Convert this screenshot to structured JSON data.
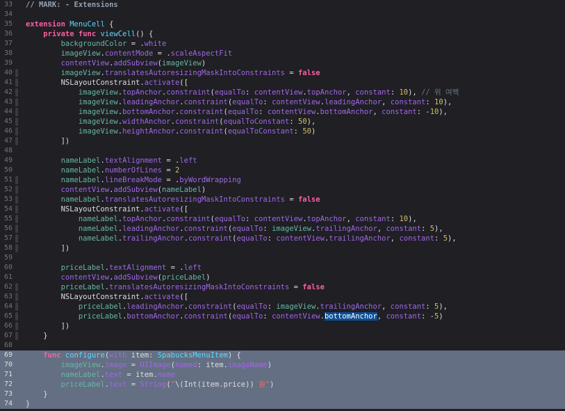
{
  "editor": {
    "first_line": 33,
    "selected_lines": [
      69,
      70,
      71,
      72,
      73,
      74
    ],
    "fold_ribbon_lines": [
      40,
      41,
      42,
      43,
      44,
      45,
      46,
      47,
      51,
      52,
      53,
      54,
      55,
      56,
      57,
      58,
      62,
      63,
      64,
      65,
      66,
      67
    ],
    "lines": [
      [
        {
          "t": "// MARK: - Extensions",
          "c": "mk"
        }
      ],
      [],
      [
        {
          "t": "extension",
          "c": "kw"
        },
        {
          "t": " "
        },
        {
          "t": "MenuCell",
          "c": "ty"
        },
        {
          "t": " {"
        }
      ],
      [
        {
          "t": "    "
        },
        {
          "t": "private",
          "c": "kw"
        },
        {
          "t": " "
        },
        {
          "t": "func",
          "c": "kw"
        },
        {
          "t": " "
        },
        {
          "t": "viewCell",
          "c": "ty"
        },
        {
          "t": "() {"
        }
      ],
      [
        {
          "t": "        "
        },
        {
          "t": "backgroundColor",
          "c": "prop"
        },
        {
          "t": " = ."
        },
        {
          "t": "white",
          "c": "fn"
        }
      ],
      [
        {
          "t": "        "
        },
        {
          "t": "imageView",
          "c": "prop"
        },
        {
          "t": "."
        },
        {
          "t": "contentMode",
          "c": "fn"
        },
        {
          "t": " = ."
        },
        {
          "t": "scaleAspectFit",
          "c": "fn"
        }
      ],
      [
        {
          "t": "        "
        },
        {
          "t": "contentView",
          "c": "fn"
        },
        {
          "t": "."
        },
        {
          "t": "addSubview",
          "c": "fn"
        },
        {
          "t": "("
        },
        {
          "t": "imageView",
          "c": "prop"
        },
        {
          "t": ")"
        }
      ],
      [
        {
          "t": "        "
        },
        {
          "t": "imageView",
          "c": "prop"
        },
        {
          "t": "."
        },
        {
          "t": "translatesAutoresizingMaskIntoConstraints",
          "c": "fn"
        },
        {
          "t": " = "
        },
        {
          "t": "false",
          "c": "kw"
        }
      ],
      [
        {
          "t": "        NSLayoutConstraint."
        },
        {
          "t": "activate",
          "c": "fn"
        },
        {
          "t": "(["
        }
      ],
      [
        {
          "t": "            "
        },
        {
          "t": "imageView",
          "c": "prop"
        },
        {
          "t": "."
        },
        {
          "t": "topAnchor",
          "c": "fn"
        },
        {
          "t": "."
        },
        {
          "t": "constraint",
          "c": "fn"
        },
        {
          "t": "("
        },
        {
          "t": "equalTo",
          "c": "fn"
        },
        {
          "t": ": "
        },
        {
          "t": "contentView",
          "c": "fn"
        },
        {
          "t": "."
        },
        {
          "t": "topAnchor",
          "c": "fn"
        },
        {
          "t": ", "
        },
        {
          "t": "constant",
          "c": "fn"
        },
        {
          "t": ": "
        },
        {
          "t": "10",
          "c": "num"
        },
        {
          "t": "), "
        },
        {
          "t": "// 위 여백",
          "c": "cm"
        }
      ],
      [
        {
          "t": "            "
        },
        {
          "t": "imageView",
          "c": "prop"
        },
        {
          "t": "."
        },
        {
          "t": "leadingAnchor",
          "c": "fn"
        },
        {
          "t": "."
        },
        {
          "t": "constraint",
          "c": "fn"
        },
        {
          "t": "("
        },
        {
          "t": "equalTo",
          "c": "fn"
        },
        {
          "t": ": "
        },
        {
          "t": "contentView",
          "c": "fn"
        },
        {
          "t": "."
        },
        {
          "t": "leadingAnchor",
          "c": "fn"
        },
        {
          "t": ", "
        },
        {
          "t": "constant",
          "c": "fn"
        },
        {
          "t": ": "
        },
        {
          "t": "10",
          "c": "num"
        },
        {
          "t": "),"
        }
      ],
      [
        {
          "t": "            "
        },
        {
          "t": "imageView",
          "c": "prop"
        },
        {
          "t": "."
        },
        {
          "t": "bottomAnchor",
          "c": "fn"
        },
        {
          "t": "."
        },
        {
          "t": "constraint",
          "c": "fn"
        },
        {
          "t": "("
        },
        {
          "t": "equalTo",
          "c": "fn"
        },
        {
          "t": ": "
        },
        {
          "t": "contentView",
          "c": "fn"
        },
        {
          "t": "."
        },
        {
          "t": "bottomAnchor",
          "c": "fn"
        },
        {
          "t": ", "
        },
        {
          "t": "constant",
          "c": "fn"
        },
        {
          "t": ": -"
        },
        {
          "t": "10",
          "c": "num"
        },
        {
          "t": "),"
        }
      ],
      [
        {
          "t": "            "
        },
        {
          "t": "imageView",
          "c": "prop"
        },
        {
          "t": "."
        },
        {
          "t": "widthAnchor",
          "c": "fn"
        },
        {
          "t": "."
        },
        {
          "t": "constraint",
          "c": "fn"
        },
        {
          "t": "("
        },
        {
          "t": "equalToConstant",
          "c": "fn"
        },
        {
          "t": ": "
        },
        {
          "t": "50",
          "c": "num"
        },
        {
          "t": "),"
        }
      ],
      [
        {
          "t": "            "
        },
        {
          "t": "imageView",
          "c": "prop"
        },
        {
          "t": "."
        },
        {
          "t": "heightAnchor",
          "c": "fn"
        },
        {
          "t": "."
        },
        {
          "t": "constraint",
          "c": "fn"
        },
        {
          "t": "("
        },
        {
          "t": "equalToConstant",
          "c": "fn"
        },
        {
          "t": ": "
        },
        {
          "t": "50",
          "c": "num"
        },
        {
          "t": ")"
        }
      ],
      [
        {
          "t": "        ])"
        }
      ],
      [
        {
          "t": "        "
        }
      ],
      [
        {
          "t": "        "
        },
        {
          "t": "nameLabel",
          "c": "prop"
        },
        {
          "t": "."
        },
        {
          "t": "textAlignment",
          "c": "fn"
        },
        {
          "t": " = ."
        },
        {
          "t": "left",
          "c": "fn"
        }
      ],
      [
        {
          "t": "        "
        },
        {
          "t": "nameLabel",
          "c": "prop"
        },
        {
          "t": "."
        },
        {
          "t": "numberOfLines",
          "c": "fn"
        },
        {
          "t": " = "
        },
        {
          "t": "2",
          "c": "num"
        }
      ],
      [
        {
          "t": "        "
        },
        {
          "t": "nameLabel",
          "c": "prop"
        },
        {
          "t": "."
        },
        {
          "t": "lineBreakMode",
          "c": "fn"
        },
        {
          "t": " = ."
        },
        {
          "t": "byWordWrapping",
          "c": "fn"
        }
      ],
      [
        {
          "t": "        "
        },
        {
          "t": "contentView",
          "c": "fn"
        },
        {
          "t": "."
        },
        {
          "t": "addSubview",
          "c": "fn"
        },
        {
          "t": "("
        },
        {
          "t": "nameLabel",
          "c": "prop"
        },
        {
          "t": ")"
        }
      ],
      [
        {
          "t": "        "
        },
        {
          "t": "nameLabel",
          "c": "prop"
        },
        {
          "t": "."
        },
        {
          "t": "translatesAutoresizingMaskIntoConstraints",
          "c": "fn"
        },
        {
          "t": " = "
        },
        {
          "t": "false",
          "c": "kw"
        }
      ],
      [
        {
          "t": "        NSLayoutConstraint."
        },
        {
          "t": "activate",
          "c": "fn"
        },
        {
          "t": "(["
        }
      ],
      [
        {
          "t": "            "
        },
        {
          "t": "nameLabel",
          "c": "prop"
        },
        {
          "t": "."
        },
        {
          "t": "topAnchor",
          "c": "fn"
        },
        {
          "t": "."
        },
        {
          "t": "constraint",
          "c": "fn"
        },
        {
          "t": "("
        },
        {
          "t": "equalTo",
          "c": "fn"
        },
        {
          "t": ": "
        },
        {
          "t": "contentView",
          "c": "fn"
        },
        {
          "t": "."
        },
        {
          "t": "topAnchor",
          "c": "fn"
        },
        {
          "t": ", "
        },
        {
          "t": "constant",
          "c": "fn"
        },
        {
          "t": ": "
        },
        {
          "t": "10",
          "c": "num"
        },
        {
          "t": "),"
        }
      ],
      [
        {
          "t": "            "
        },
        {
          "t": "nameLabel",
          "c": "prop"
        },
        {
          "t": "."
        },
        {
          "t": "leadingAnchor",
          "c": "fn"
        },
        {
          "t": "."
        },
        {
          "t": "constraint",
          "c": "fn"
        },
        {
          "t": "("
        },
        {
          "t": "equalTo",
          "c": "fn"
        },
        {
          "t": ": "
        },
        {
          "t": "imageView",
          "c": "prop"
        },
        {
          "t": "."
        },
        {
          "t": "trailingAnchor",
          "c": "fn"
        },
        {
          "t": ", "
        },
        {
          "t": "constant",
          "c": "fn"
        },
        {
          "t": ": "
        },
        {
          "t": "5",
          "c": "num"
        },
        {
          "t": "),"
        }
      ],
      [
        {
          "t": "            "
        },
        {
          "t": "nameLabel",
          "c": "prop"
        },
        {
          "t": "."
        },
        {
          "t": "trailingAnchor",
          "c": "fn"
        },
        {
          "t": "."
        },
        {
          "t": "constraint",
          "c": "fn"
        },
        {
          "t": "("
        },
        {
          "t": "equalTo",
          "c": "fn"
        },
        {
          "t": ": "
        },
        {
          "t": "contentView",
          "c": "fn"
        },
        {
          "t": "."
        },
        {
          "t": "trailingAnchor",
          "c": "fn"
        },
        {
          "t": ", "
        },
        {
          "t": "constant",
          "c": "fn"
        },
        {
          "t": ": "
        },
        {
          "t": "5",
          "c": "num"
        },
        {
          "t": "),"
        }
      ],
      [
        {
          "t": "        ])"
        }
      ],
      [
        {
          "t": "        "
        }
      ],
      [
        {
          "t": "        "
        },
        {
          "t": "priceLabel",
          "c": "prop"
        },
        {
          "t": "."
        },
        {
          "t": "textAlignment",
          "c": "fn"
        },
        {
          "t": " = ."
        },
        {
          "t": "left",
          "c": "fn"
        }
      ],
      [
        {
          "t": "        "
        },
        {
          "t": "contentView",
          "c": "fn"
        },
        {
          "t": "."
        },
        {
          "t": "addSubview",
          "c": "fn"
        },
        {
          "t": "("
        },
        {
          "t": "priceLabel",
          "c": "prop"
        },
        {
          "t": ")"
        }
      ],
      [
        {
          "t": "        "
        },
        {
          "t": "priceLabel",
          "c": "prop"
        },
        {
          "t": "."
        },
        {
          "t": "translatesAutoresizingMaskIntoConstraints",
          "c": "fn"
        },
        {
          "t": " = "
        },
        {
          "t": "false",
          "c": "kw"
        }
      ],
      [
        {
          "t": "        NSLayoutConstraint."
        },
        {
          "t": "activate",
          "c": "fn"
        },
        {
          "t": "(["
        }
      ],
      [
        {
          "t": "            "
        },
        {
          "t": "priceLabel",
          "c": "prop"
        },
        {
          "t": "."
        },
        {
          "t": "leadingAnchor",
          "c": "fn"
        },
        {
          "t": "."
        },
        {
          "t": "constraint",
          "c": "fn"
        },
        {
          "t": "("
        },
        {
          "t": "equalTo",
          "c": "fn"
        },
        {
          "t": ": "
        },
        {
          "t": "imageView",
          "c": "prop"
        },
        {
          "t": "."
        },
        {
          "t": "trailingAnchor",
          "c": "fn"
        },
        {
          "t": ", "
        },
        {
          "t": "constant",
          "c": "fn"
        },
        {
          "t": ": "
        },
        {
          "t": "5",
          "c": "num"
        },
        {
          "t": "),"
        }
      ],
      [
        {
          "t": "            "
        },
        {
          "t": "priceLabel",
          "c": "prop"
        },
        {
          "t": "."
        },
        {
          "t": "bottomAnchor",
          "c": "fn"
        },
        {
          "t": "."
        },
        {
          "t": "constraint",
          "c": "fn"
        },
        {
          "t": "("
        },
        {
          "t": "equalTo",
          "c": "fn"
        },
        {
          "t": ": "
        },
        {
          "t": "contentView",
          "c": "fn"
        },
        {
          "t": "."
        },
        {
          "t": "bottomAnchor",
          "c": "hl"
        },
        {
          "t": ", "
        },
        {
          "t": "constant",
          "c": "fn"
        },
        {
          "t": ": -"
        },
        {
          "t": "5",
          "c": "num"
        },
        {
          "t": ")"
        }
      ],
      [
        {
          "t": "        ])"
        }
      ],
      [
        {
          "t": "    }"
        }
      ],
      [
        {
          "t": "    "
        }
      ],
      [
        {
          "t": "    "
        },
        {
          "t": "func",
          "c": "kw"
        },
        {
          "t": " "
        },
        {
          "t": "configure",
          "c": "ty"
        },
        {
          "t": "("
        },
        {
          "t": "with",
          "c": "fn"
        },
        {
          "t": " item: "
        },
        {
          "t": "SpabucksMenuItem",
          "c": "ty"
        },
        {
          "t": ") {"
        }
      ],
      [
        {
          "t": "        "
        },
        {
          "t": "imageView",
          "c": "prop"
        },
        {
          "t": "."
        },
        {
          "t": "image",
          "c": "fn"
        },
        {
          "t": " = "
        },
        {
          "t": "UIImage",
          "c": "fn"
        },
        {
          "t": "("
        },
        {
          "t": "named",
          "c": "fn"
        },
        {
          "t": ": item."
        },
        {
          "t": "imageName",
          "c": "fn"
        },
        {
          "t": ")"
        }
      ],
      [
        {
          "t": "        "
        },
        {
          "t": "nameLabel",
          "c": "prop"
        },
        {
          "t": "."
        },
        {
          "t": "text",
          "c": "fn"
        },
        {
          "t": " = item."
        },
        {
          "t": "name",
          "c": "fn"
        }
      ],
      [
        {
          "t": "        "
        },
        {
          "t": "priceLabel",
          "c": "prop"
        },
        {
          "t": "."
        },
        {
          "t": "text",
          "c": "fn"
        },
        {
          "t": " = "
        },
        {
          "t": "String",
          "c": "fn"
        },
        {
          "t": "("
        },
        {
          "t": "\"",
          "c": "str"
        },
        {
          "t": "\\(Int(item.price)) "
        },
        {
          "t": "원\"",
          "c": "str"
        },
        {
          "t": ")"
        }
      ],
      [
        {
          "t": "    }"
        }
      ],
      [
        {
          "t": "}"
        }
      ]
    ]
  }
}
